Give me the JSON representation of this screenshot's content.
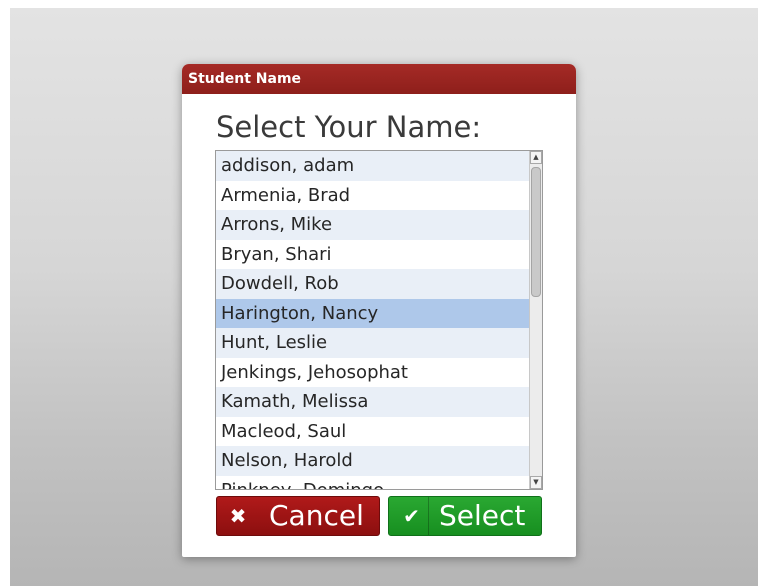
{
  "dialog": {
    "title": "Student Name",
    "prompt": "Select Your Name:"
  },
  "list": {
    "selected_index": 5,
    "items": [
      "addison, adam",
      "Armenia, Brad",
      "Arrons, Mike",
      "Bryan, Shari",
      "Dowdell, Rob",
      "Harington, Nancy",
      "Hunt, Leslie",
      "Jenkings, Jehosophat",
      "Kamath, Melissa",
      "Macleod, Saul",
      "Nelson, Harold",
      "Pinkney, Domingo"
    ]
  },
  "buttons": {
    "cancel_label": "Cancel",
    "cancel_icon": "x-icon",
    "select_label": "Select",
    "select_icon": "checkmark-icon"
  },
  "colors": {
    "title_bar": "#9b2420",
    "cancel_button": "#a01616",
    "select_button": "#22a02b",
    "selected_row": "#aec8ea"
  }
}
